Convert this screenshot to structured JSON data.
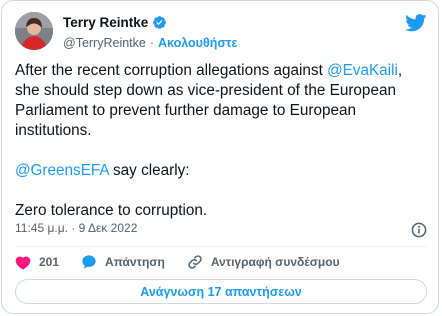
{
  "tweet": {
    "author_name": "Terry Reintke",
    "handle": "@TerryReintke",
    "separator": "·",
    "follow_label": "Ακολουθήστε",
    "text_part1": "After the recent corruption allegations against ",
    "mention1": "@EvaKaili",
    "text_part2": ", she should step down as vice-president of the European Parliament to prevent further damage to European institutions.",
    "mention2": "@GreensEFA",
    "text_part3": " say clearly:",
    "text_part4": "Zero tolerance to corruption.",
    "timestamp": "11:45 μ.μ. · 9 Δεκ 2022"
  },
  "actions": {
    "like_count": "201",
    "reply_label": "Απάντηση",
    "copy_link_label": "Αντιγραφή συνδέσμου"
  },
  "replies_button_label": "Ανάγνωση 17 απαντήσεων",
  "colors": {
    "accent": "#1d9bf0",
    "like": "#f91880",
    "text": "#0f1419",
    "muted": "#536471"
  }
}
